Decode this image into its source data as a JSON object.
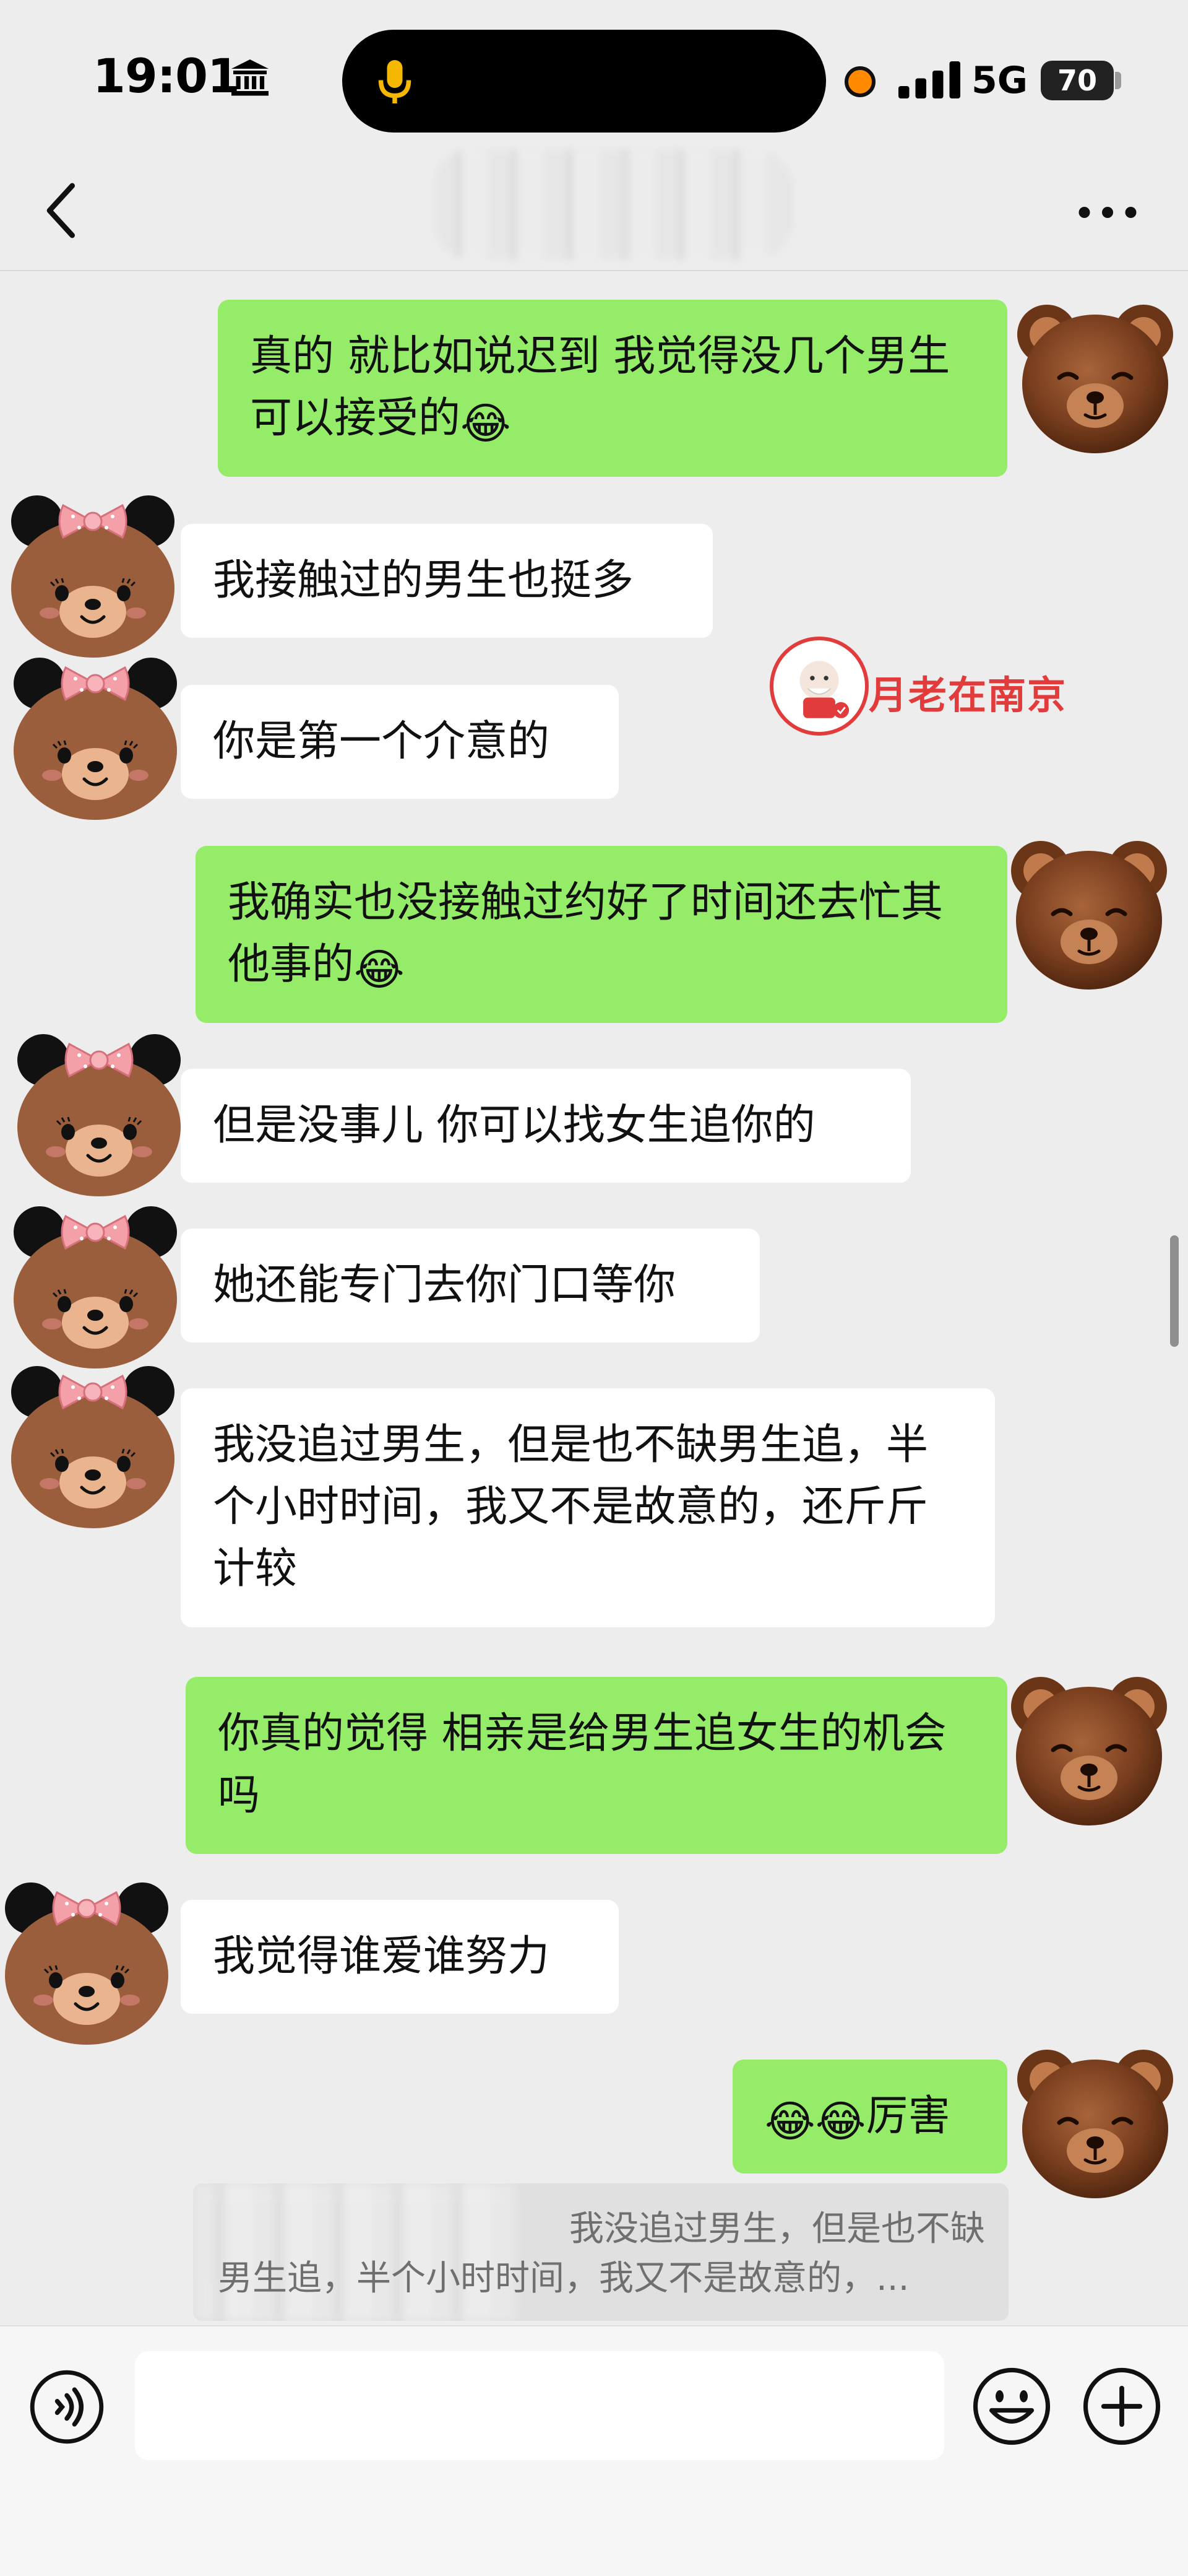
{
  "status_bar": {
    "time": "19:01",
    "network": "5G",
    "battery": "70",
    "icons": [
      "bank-icon",
      "microphone-icon",
      "recording-dot-icon",
      "signal-icon",
      "battery-icon"
    ]
  },
  "nav": {
    "icons": [
      "chevron-left-icon",
      "more-dots-icon"
    ]
  },
  "watermark": {
    "text": "月老在南京"
  },
  "messages": [
    {
      "side": "out",
      "text": "真的 就比如说迟到 我觉得没几个男生可以接受的",
      "emoji": "😂"
    },
    {
      "side": "in",
      "text": "我接触过的男生也挺多"
    },
    {
      "side": "in",
      "text": "你是第一个介意的"
    },
    {
      "side": "out",
      "text": "我确实也没接触过约好了时间还去忙其他事的",
      "emoji": "😂"
    },
    {
      "side": "in",
      "text": "但是没事儿 你可以找女生追你的"
    },
    {
      "side": "in",
      "text": "她还能专门去你门口等你"
    },
    {
      "side": "in",
      "text": "我没追过男生，但是也不缺男生追，半个小时时间，我又不是故意的，还斤斤计较"
    },
    {
      "side": "out",
      "text": "你真的觉得 相亲是给男生追女生的机会吗"
    },
    {
      "side": "in",
      "text": "我觉得谁爱谁努力"
    },
    {
      "side": "out",
      "emoji_prefix": "😂😂",
      "text": "厉害"
    }
  ],
  "quote": {
    "line1": "我没追过男生，但是也不缺",
    "line2": "男生追，半个小时时间，我又不是故意的，..."
  },
  "input": {
    "placeholder": ""
  },
  "colors": {
    "background": "#ededed",
    "outgoing_bubble": "#95ec69",
    "incoming_bubble": "#ffffff",
    "watermark": "#e23b3b"
  }
}
